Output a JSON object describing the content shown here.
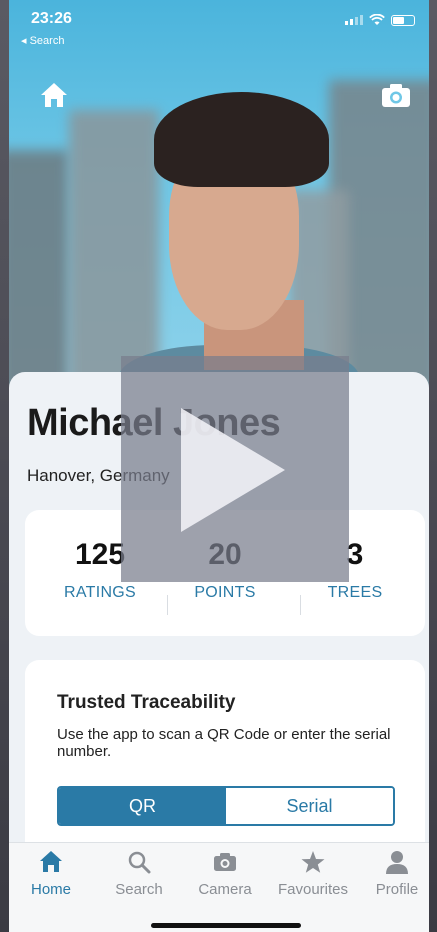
{
  "status": {
    "time": "23:26",
    "back_label": "◂ Search"
  },
  "profile": {
    "name": "Michael Jones",
    "location": "Hanover, Germany"
  },
  "stats": [
    {
      "value": "125",
      "label": "RATINGS"
    },
    {
      "value": "20",
      "label": "POINTS"
    },
    {
      "value": "3",
      "label": "TREES"
    }
  ],
  "trace": {
    "title": "Trusted Traceability",
    "description": "Use the app to scan a QR Code or enter the serial number.",
    "options": [
      "QR",
      "Serial"
    ],
    "selected": "QR"
  },
  "tabs": [
    {
      "label": "Home",
      "icon": "home-icon",
      "active": true
    },
    {
      "label": "Search",
      "icon": "search-icon"
    },
    {
      "label": "Camera",
      "icon": "camera-icon"
    },
    {
      "label": "Favourites",
      "icon": "star-icon"
    },
    {
      "label": "Profile",
      "icon": "person-icon"
    }
  ],
  "colors": {
    "accent": "#2a7aa6",
    "sky": "#4bb4dc"
  }
}
